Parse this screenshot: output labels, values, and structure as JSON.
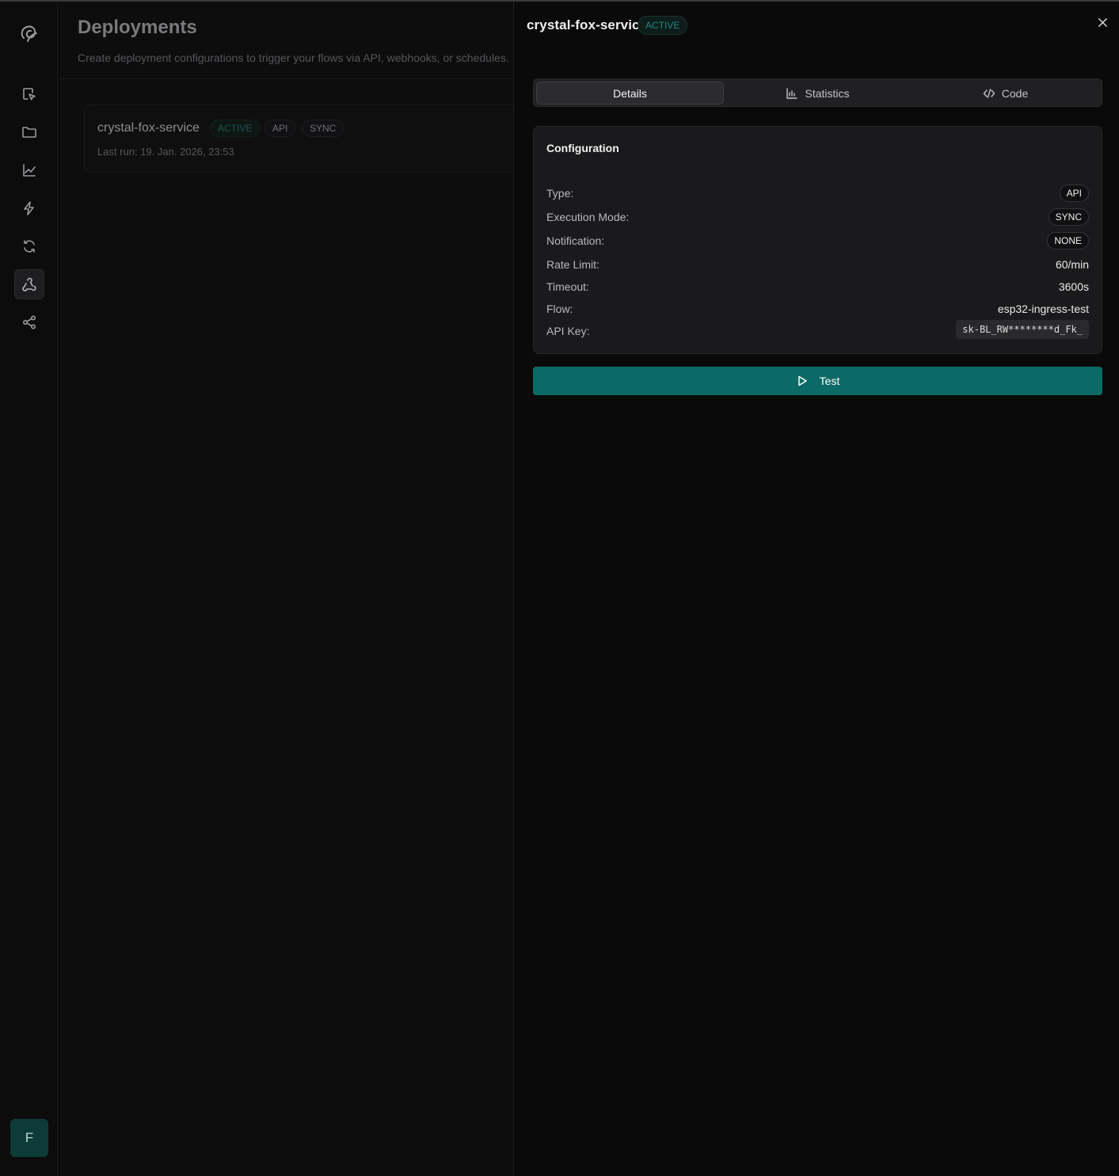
{
  "sidebar": {
    "items": [
      {
        "icon": "edit-cursor-icon"
      },
      {
        "icon": "folder-icon"
      },
      {
        "icon": "chart-line-icon"
      },
      {
        "icon": "lightning-icon"
      },
      {
        "icon": "refresh-icon"
      },
      {
        "icon": "webhook-icon",
        "active": true
      },
      {
        "icon": "share-icon"
      }
    ],
    "avatar_initial": "F"
  },
  "main": {
    "title": "Deployments",
    "subtitle": "Create deployment configurations to trigger your flows via API, webhooks, or schedules.",
    "deployment": {
      "name": "crystal-fox-service",
      "status": "ACTIVE",
      "type": "API",
      "mode": "SYNC",
      "last_run": "Last run: 19. Jan. 2026, 23:53"
    }
  },
  "drawer": {
    "title": "crystal-fox-service",
    "status": "ACTIVE",
    "close_icon": "close-icon",
    "tabs": [
      {
        "label": "Details",
        "active": true
      },
      {
        "label": "Statistics",
        "icon": "bar-chart-icon"
      },
      {
        "label": "Code",
        "icon": "code-icon"
      }
    ],
    "config": {
      "title": "Configuration",
      "type_label": "Type:",
      "type_value": "API",
      "mode_label": "Execution Mode:",
      "mode_value": "SYNC",
      "notification_label": "Notification:",
      "notification_value": "NONE",
      "rate_label": "Rate Limit:",
      "rate_value": "60/min",
      "timeout_label": "Timeout:",
      "timeout_value": "3600s",
      "flow_label": "Flow:",
      "flow_value": "esp32-ingress-test",
      "apikey_label": "API Key:",
      "apikey_value": "sk-BL_RW********d_Fk_"
    },
    "test_button": "Test"
  },
  "colors": {
    "accent": "#0b6a65",
    "active_text": "#1f8a7c"
  }
}
